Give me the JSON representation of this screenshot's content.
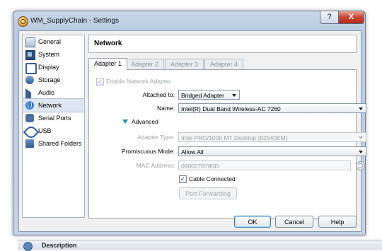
{
  "window": {
    "title": "WM_SupplyChain - Settings",
    "help_button": "?",
    "close_button": "X"
  },
  "sidebar": {
    "items": [
      {
        "label": "General",
        "icon": "general-icon"
      },
      {
        "label": "System",
        "icon": "chip-icon"
      },
      {
        "label": "Display",
        "icon": "monitor-icon"
      },
      {
        "label": "Storage",
        "icon": "disk-icon"
      },
      {
        "label": "Audio",
        "icon": "speaker-icon"
      },
      {
        "label": "Network",
        "icon": "globe-icon",
        "selected": true
      },
      {
        "label": "Serial Ports",
        "icon": "serial-icon"
      },
      {
        "label": "USB",
        "icon": "usb-icon"
      },
      {
        "label": "Shared Folders",
        "icon": "folder-icon"
      }
    ]
  },
  "page": {
    "title": "Network"
  },
  "tabs": [
    {
      "label": "Adapter 1",
      "active": true
    },
    {
      "label": "Adapter 2",
      "active": false
    },
    {
      "label": "Adapter 3",
      "active": false
    },
    {
      "label": "Adapter 4",
      "active": false
    }
  ],
  "adapter": {
    "enable_label": "Enable Network Adapter",
    "enable_checked": true,
    "attached_label": "Attached to:",
    "attached_value": "Bridged Adapter",
    "name_label": "Name:",
    "name_value": "Intel(R) Dual Band Wireless-AC 7260",
    "advanced_label": "Advanced",
    "adapter_type_label": "Adapter Type:",
    "adapter_type_value": "Intel PRO/1000 MT Desktop (82540EM)",
    "promiscuous_label": "Promiscuous Mode:",
    "promiscuous_value": "Allow All",
    "mac_label": "MAC Address:",
    "mac_value": "0800278785D",
    "cable_label": "Cable Connected",
    "cable_checked": true,
    "port_forwarding_label": "Port Forwarding"
  },
  "footer": {
    "ok": "OK",
    "cancel": "Cancel",
    "help": "Help"
  },
  "background": {
    "description_label": "Description"
  },
  "colors": {
    "accent": "#1f8fd0",
    "selection": "#dde6f1"
  }
}
